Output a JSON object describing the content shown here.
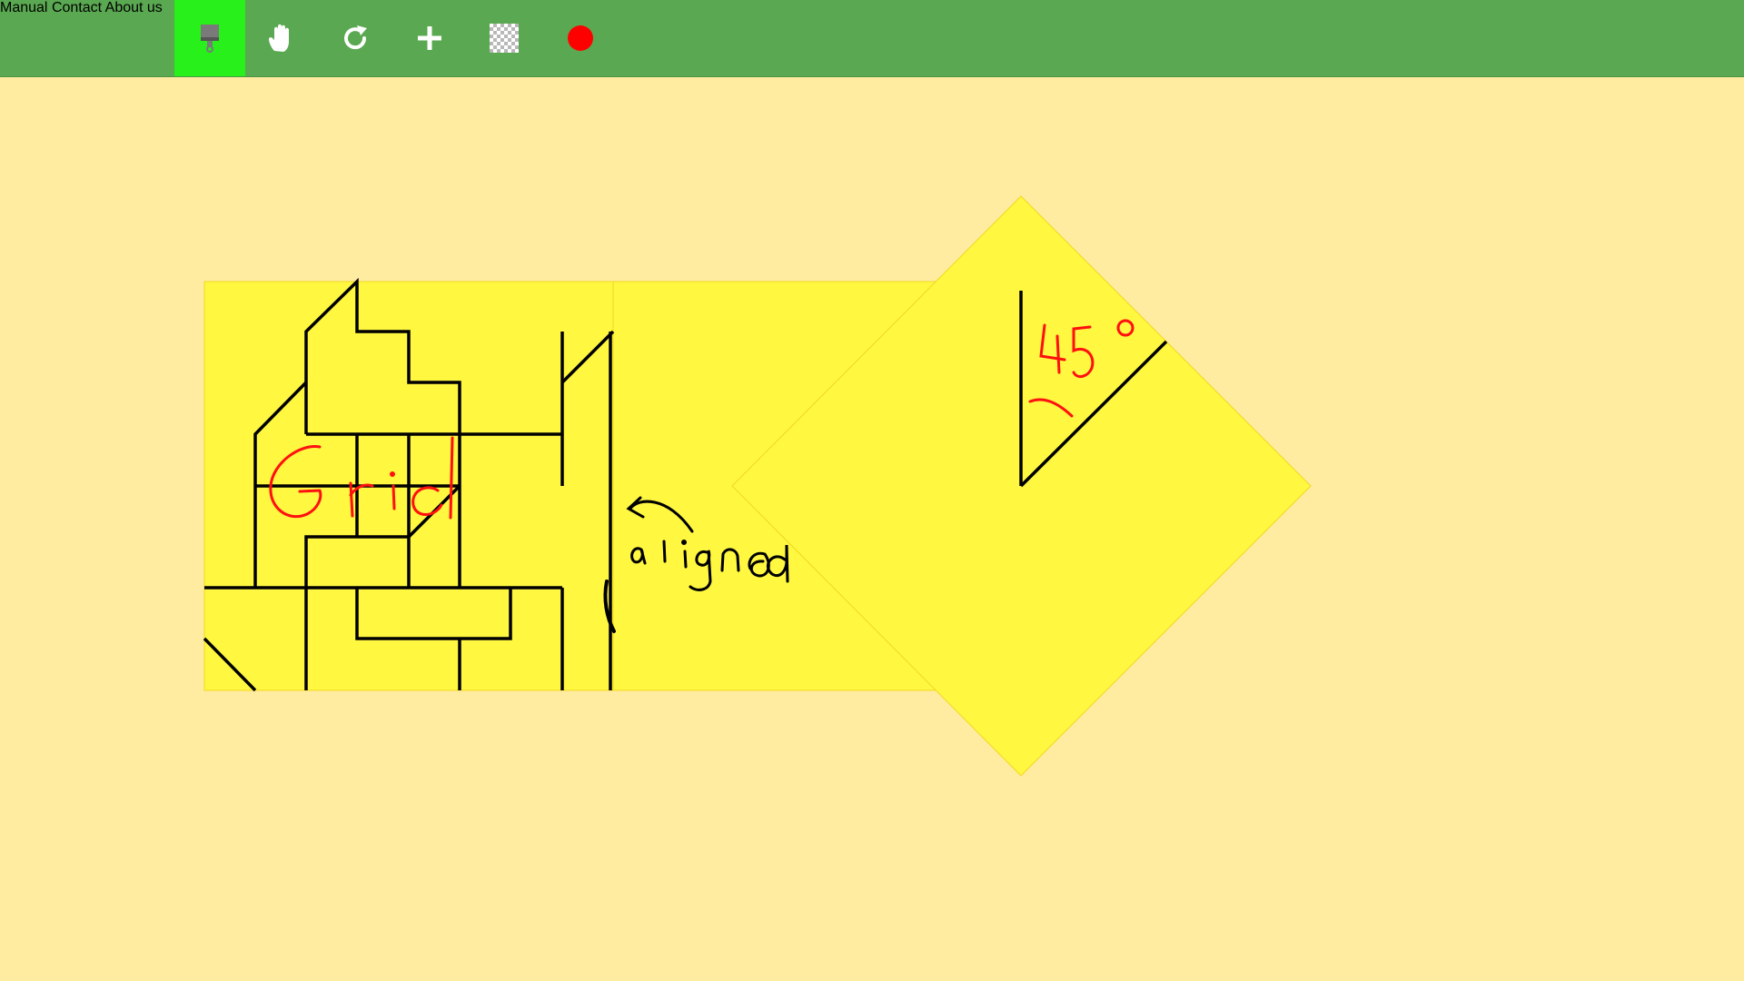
{
  "toolbar": {
    "tools": [
      {
        "name": "paint-brush-icon",
        "active": true
      },
      {
        "name": "hand-pan-icon",
        "active": false
      },
      {
        "name": "redo-icon",
        "active": false
      },
      {
        "name": "add-icon",
        "active": false
      },
      {
        "name": "checkerboard-pattern-icon",
        "active": false
      },
      {
        "name": "color-swatch-icon",
        "active": false
      }
    ],
    "current_color": "#ff0000",
    "active_tool_bg": "#27f01a",
    "bar_color": "#5aa851"
  },
  "nav": {
    "manual": "Manual",
    "contact": "Contact",
    "about": "About us"
  },
  "canvas": {
    "background": "#ffeca0",
    "note_color": "#fff740",
    "annotations": {
      "grid_label": "Grid",
      "aligned_label": "aligned",
      "angle_label": "45°"
    }
  }
}
